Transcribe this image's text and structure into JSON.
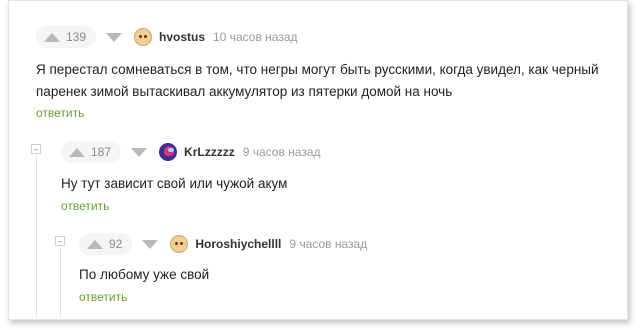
{
  "comments": [
    {
      "votes": "139",
      "author": "hvostus",
      "time": "10 часов назад",
      "avatar_icon": "face-avatar-icon",
      "text_lines": [
        "Я перестал сомневаться в том, что негры могут быть русскими, когда увидел, как черный",
        "паренек зимой вытаскивал аккумулятор из пятерки домой на ночь"
      ],
      "reply_label": "ответить"
    },
    {
      "votes": "187",
      "author": "KrLzzzzz",
      "time": "9 часов назад",
      "avatar_icon": "among-us-avatar-icon",
      "text_lines": [
        "Ну тут зависит свой или чужой акум"
      ],
      "reply_label": "ответить"
    },
    {
      "votes": "92",
      "author": "Horoshiychellll",
      "time": "9 часов назад",
      "avatar_icon": "face-avatar-icon",
      "text_lines": [
        "По любому уже свой"
      ],
      "reply_label": "ответить"
    }
  ],
  "colors": {
    "vote_text": "#8a8a8a",
    "author_text": "#333333",
    "time_text": "#9a9a9a",
    "reply_link": "#6a9f30",
    "arrow": "#b8b8b8"
  },
  "icons": {
    "upvote": "upvote-arrow-icon",
    "downvote": "downvote-arrow-icon",
    "collapse": "collapse-thread-icon"
  }
}
